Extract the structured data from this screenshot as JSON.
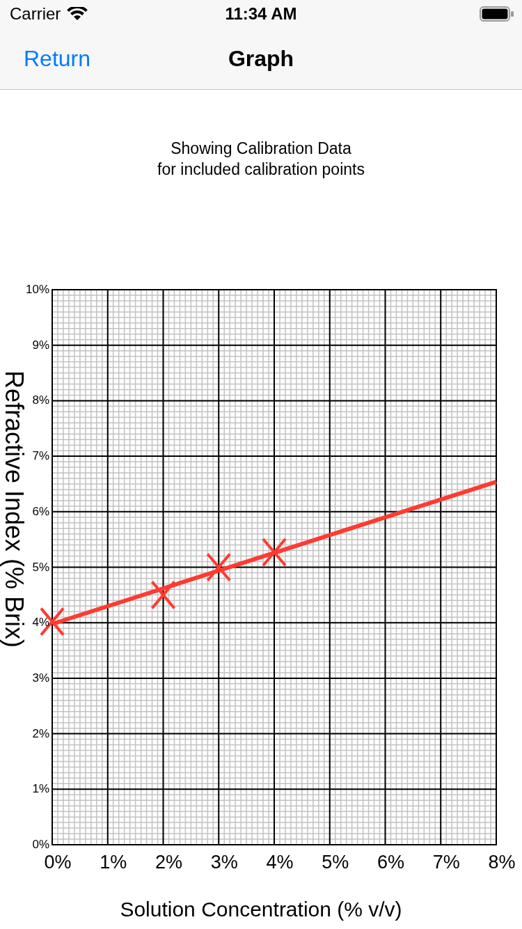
{
  "status_bar": {
    "carrier": "Carrier",
    "time": "11:34 AM"
  },
  "nav_bar": {
    "back_button": "Return",
    "title": "Graph"
  },
  "graph": {
    "show_trend_line": true,
    "chart_data": {
      "type": "scatter",
      "title": "Showing Calibration Data\nfor included calibration points",
      "xlabel": "Solution Concentration (% v/v)",
      "ylabel": "Refractive Index (% Brix)",
      "x": [
        0,
        2,
        3,
        4
      ],
      "series": [
        {
          "color": "#ff3b30",
          "marker": "x",
          "values": [
            4.02,
            4.5,
            5.0,
            5.27
          ]
        }
      ],
      "grid": true,
      "xlim": [
        0,
        8
      ],
      "ylim": [
        0,
        10
      ],
      "xticks": [
        {
          "value": 0,
          "label": "0%"
        },
        {
          "value": 1,
          "label": "1%"
        },
        {
          "value": 2,
          "label": "2%"
        },
        {
          "value": 3,
          "label": "3%"
        },
        {
          "value": 4,
          "label": "4%"
        },
        {
          "value": 5,
          "label": "5%"
        },
        {
          "value": 6,
          "label": "6%"
        },
        {
          "value": 7,
          "label": "7%"
        },
        {
          "value": 8,
          "label": "8%"
        }
      ],
      "yticks": [
        {
          "value": 0,
          "label": "0%"
        },
        {
          "value": 1,
          "label": "1%"
        },
        {
          "value": 2,
          "label": "2%"
        },
        {
          "value": 3,
          "label": "3%"
        },
        {
          "value": 4,
          "label": "4%"
        },
        {
          "value": 5,
          "label": "5%"
        },
        {
          "value": 6,
          "label": "6%"
        },
        {
          "value": 7,
          "label": "7%"
        },
        {
          "value": 8,
          "label": "8%"
        },
        {
          "value": 9,
          "label": "9%"
        },
        {
          "value": 10,
          "label": "10%"
        }
      ]
    }
  }
}
